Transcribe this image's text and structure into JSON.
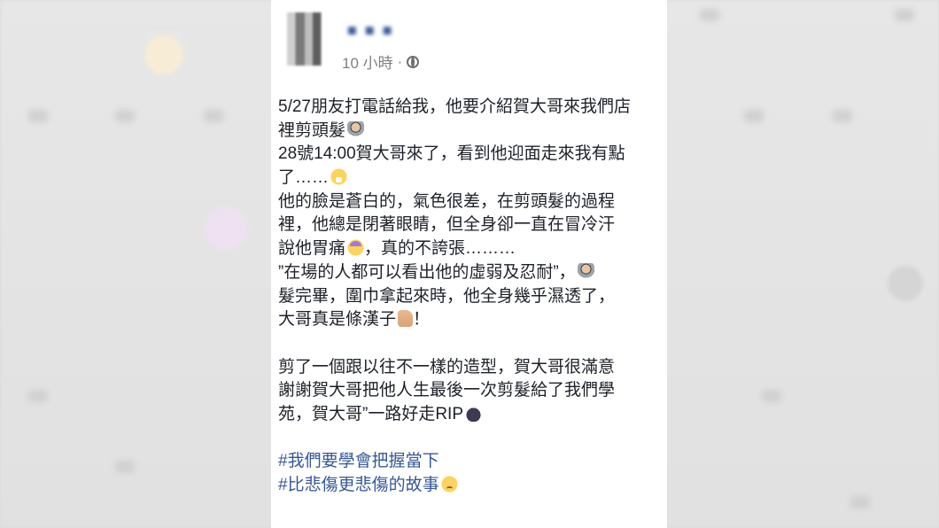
{
  "post": {
    "author": "■ ■ ■",
    "timestamp": "10 小時",
    "separator": "·",
    "privacy_icon": "globe-icon",
    "lines": [
      "5/27朋友打電話給我，他要介紹賀大哥來我們店",
      "裡剪頭髮",
      "28號14:00賀大哥來了，看到他迎面走來我有點",
      "了……",
      "他的臉是蒼白的，氣色很差，在剪頭髮的過程",
      "裡，他總是閉著眼睛，但全身卻一直在冒冷汗",
      "說他胃痛",
      "，真的不誇張………",
      "”在場的人都可以看出他的虛弱及忍耐”，",
      "髮完畢，圍巾拿起來時，他全身幾乎濕透了，",
      "大哥真是條漢子",
      "！",
      "剪了一個跟以往不一樣的造型，賀大哥很滿意",
      "謝謝賀大哥把他人生最後一次剪髮給了我們學",
      "苑，賀大哥”一路好走RIP"
    ],
    "hashtags": [
      "#我們要學會把握當下",
      "#比悲傷更悲傷的故事"
    ],
    "emoji_icons": [
      "barber-emoji-icon",
      "shocked-emoji-icon",
      "sick-emoji-icon",
      "barber-emoji-icon",
      "thumbs-up-emoji-icon",
      "cat-emoji-icon",
      "sad-emoji-icon"
    ]
  },
  "colors": {
    "link": "#365899",
    "text": "#1d2129",
    "meta": "#7f7f7f"
  }
}
